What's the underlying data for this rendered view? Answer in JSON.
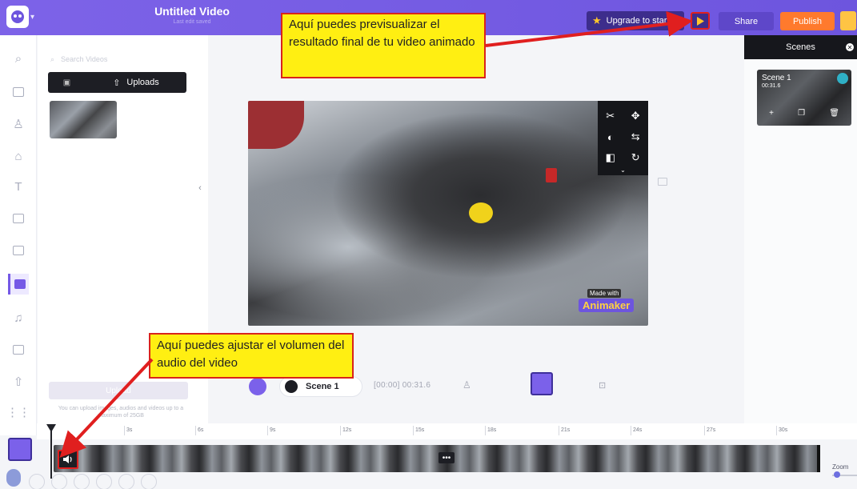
{
  "header": {
    "title": "Untitled Video",
    "subtitle": "Last edit saved",
    "upgrade_label": "Upgrade to start",
    "share_label": "Share",
    "publish_label": "Publish"
  },
  "library": {
    "search_placeholder": "Search Videos",
    "uploads_tab": "Uploads",
    "upload_button": "Upload",
    "upload_note": "You can upload images, audios and videos up to a maximum of 25GB"
  },
  "scenes": {
    "header": "Scenes",
    "items": [
      {
        "name": "Scene 1",
        "duration": "00:31.6"
      }
    ]
  },
  "canvas": {
    "watermark_made": "Made with",
    "watermark_brand": "Animaker"
  },
  "controls": {
    "scene_label": "Scene 1",
    "time_readout": "[00:00] 00:31.6"
  },
  "timeline": {
    "ticks": [
      "3s",
      "6s",
      "9s",
      "12s",
      "15s",
      "18s",
      "21s",
      "24s",
      "27s",
      "30s"
    ],
    "zoom_label": "Zoom"
  },
  "callouts": {
    "top": "Aquí puedes previsualizar  el resultado final de tu video animado",
    "bottom": "Aquí puedes ajustar el volumen del audio del video"
  },
  "colors": {
    "brand": "#7559e6",
    "publish": "#ff7a2d",
    "callout_bg": "#ffef12",
    "callout_border": "#d9241b"
  }
}
